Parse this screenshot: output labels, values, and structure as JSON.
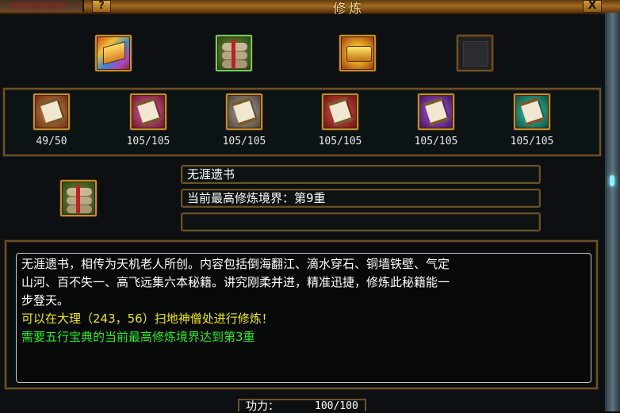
{
  "window": {
    "title": "修炼",
    "help_label": "?",
    "close_label": "X"
  },
  "top_items": [
    {
      "icon": "rainbow-book-icon",
      "selected": false
    },
    {
      "icon": "scroll-bundle-icon",
      "selected": true
    },
    {
      "icon": "gold-treasure-icon",
      "selected": false
    },
    {
      "icon": "locked-slot-icon",
      "selected": false
    }
  ],
  "manuals": [
    {
      "icon": "scroll-brown-icon",
      "count": "49/50"
    },
    {
      "icon": "scroll-pink-icon",
      "count": "105/105"
    },
    {
      "icon": "scroll-white-icon",
      "count": "105/105"
    },
    {
      "icon": "scroll-red-icon",
      "count": "105/105"
    },
    {
      "icon": "scroll-purple-icon",
      "count": "105/105"
    },
    {
      "icon": "scroll-teal-icon",
      "count": "105/105"
    }
  ],
  "detail": {
    "icon": "scroll-bundle-icon",
    "name": "无涯遗书",
    "level": "当前最高修炼境界：第9重",
    "extra": ""
  },
  "description": {
    "line1": "无涯遗书，相传为天机老人所创。内容包括倒海翻江、滴水穿石、铜墙铁壁、气定",
    "line2": "山河、百不失一、高飞远集六本秘籍。讲究刚柔并进，精准迅捷，修炼此秘籍能一",
    "line3": "步登天。",
    "location": "可以在大理（243，56）扫地神僧处进行修炼！",
    "requirement": "需要五行宝典的当前最高修炼境界达到第3重"
  },
  "power": {
    "label": "功力：",
    "value": "100/100"
  },
  "colors": {
    "frame_gold": "#6a5028",
    "icon_border": "#c68f2d",
    "selected_border": "#5fd56a",
    "text_white": "#ffffff",
    "text_yellow": "#f0e800",
    "text_green": "#22f022"
  }
}
